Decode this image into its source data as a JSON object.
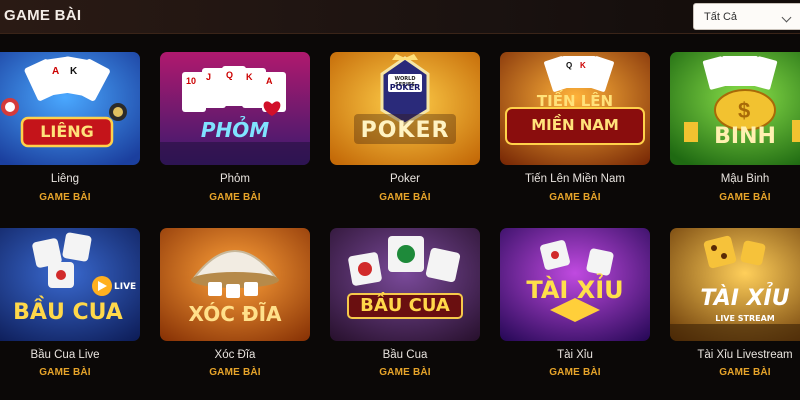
{
  "header": {
    "title": "GAME BÀI"
  },
  "filter": {
    "selected": "Tất Cả"
  },
  "games": [
    {
      "name": "Liêng",
      "category": "GAME BÀI",
      "logo": "LIÊNG",
      "icon": "cards-fan-icon"
    },
    {
      "name": "Phỏm",
      "category": "GAME BÀI",
      "logo": "PHỎM",
      "icon": "playing-cards-icon"
    },
    {
      "name": "Poker",
      "category": "GAME BÀI",
      "logo": "POKER",
      "logo_sub": "WORLD SERIES",
      "logo_sub2": "POKER",
      "icon": "poker-chip-icon"
    },
    {
      "name": "Tiến Lên Miền Nam",
      "category": "GAME BÀI",
      "logo": "TIẾN LÊN",
      "logo2": "MIỀN NAM",
      "icon": "playing-cards-icon"
    },
    {
      "name": "Mậu Binh",
      "category": "GAME BÀI",
      "logo": "BINH",
      "icon": "coin-stack-icon"
    },
    {
      "name": "Bầu Cua Live",
      "category": "GAME BÀI",
      "logo": "BẦU CUA",
      "badge": "LIVE",
      "icon": "dice-icon"
    },
    {
      "name": "Xóc Đĩa",
      "category": "GAME BÀI",
      "logo": "XÓC ĐĨA",
      "icon": "bowl-icon"
    },
    {
      "name": "Bầu Cua",
      "category": "GAME BÀI",
      "logo": "BẦU CUA",
      "icon": "dice-icon"
    },
    {
      "name": "Tài Xỉu",
      "category": "GAME BÀI",
      "logo": "TÀI XỈU",
      "icon": "dice-icon"
    },
    {
      "name": "Tài Xỉu Livestream",
      "category": "GAME BÀI",
      "logo": "TÀI XỈU",
      "logo2": "LIVE STREAM",
      "icon": "dice-icon"
    }
  ]
}
